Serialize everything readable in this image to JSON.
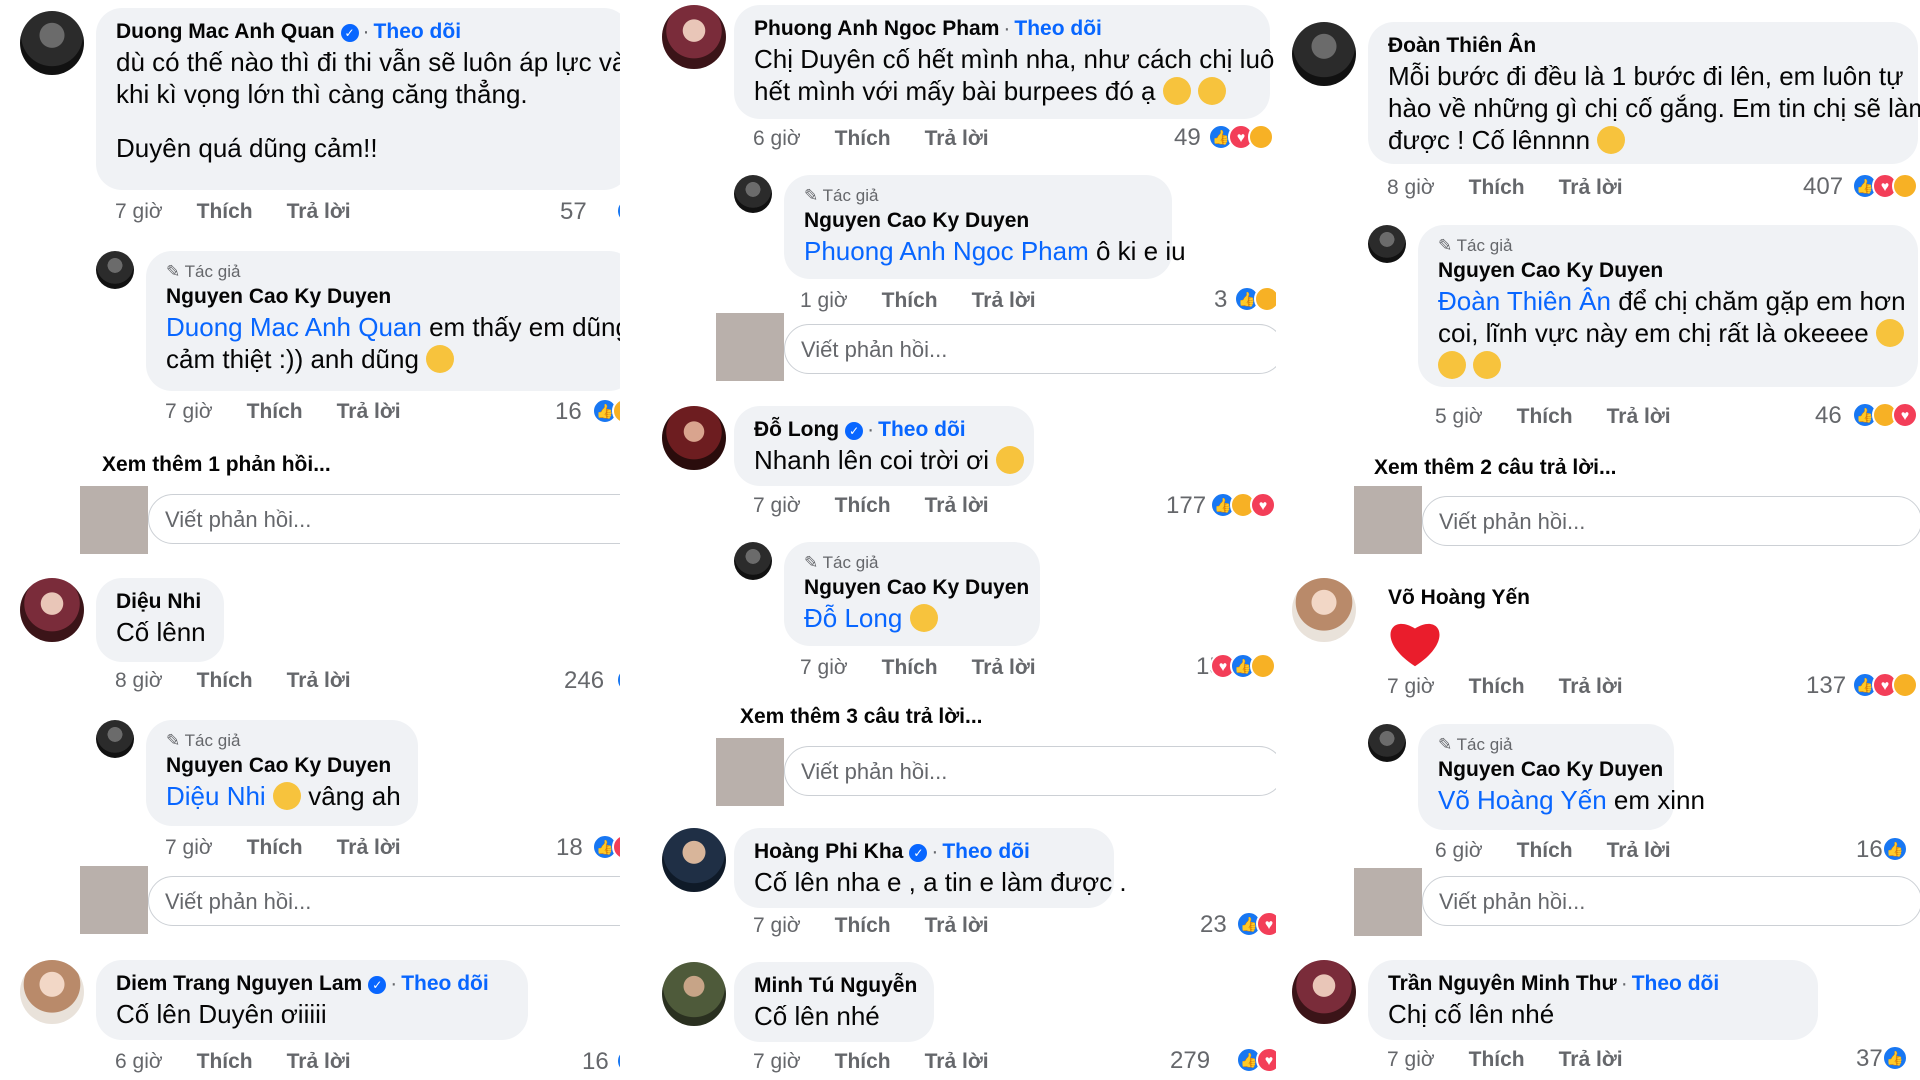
{
  "labels": {
    "follow": "Theo dõi",
    "like": "Thích",
    "reply": "Trả lời",
    "author": "Tác giả",
    "reply_placeholder": "Viết phản hồi..."
  },
  "col1": {
    "c1": {
      "name": "Duong Mac Anh Quan",
      "text": [
        "dù có thế nào thì đi thi vẫn sẽ luôn áp lực và",
        "khi kì vọng lớn thì càng căng thẳng.",
        "Duyên quá dũng cảm!!"
      ],
      "time": "7 giờ",
      "count": "57"
    },
    "r1": {
      "name": "Nguyen Cao Ky Duyen",
      "mention": "Duong Mac Anh Quan",
      "text1": " em thấy em dũng",
      "text2": "cảm thiệt :)) anh dũng",
      "time": "7 giờ",
      "count": "16"
    },
    "more1": "Xem thêm 1 phản hồi...",
    "c2": {
      "name": "Diệu Nhi",
      "text": "Cố lênn",
      "time": "8 giờ",
      "count": "246"
    },
    "r2": {
      "name": "Nguyen Cao Ky Duyen",
      "mention": "Diệu Nhi",
      "text": "vâng ah",
      "time": "7 giờ",
      "count": "18"
    },
    "c3": {
      "name": "Diem Trang Nguyen Lam",
      "text": "Cố lên Duyên ơiiiii",
      "time": "6 giờ",
      "count": "16"
    }
  },
  "col2": {
    "c1": {
      "name": "Phuong Anh Ngoc Pham",
      "text": [
        "Chị Duyên cố hết mình nha, như cách chị luôn",
        "hết mình với mấy bài burpees đó ạ"
      ],
      "time": "6 giờ",
      "count": "49"
    },
    "r1": {
      "name": "Nguyen Cao Ky Duyen",
      "mention": "Phuong Anh Ngoc Pham",
      "text": " ô ki e iu",
      "time": "1 giờ",
      "count": "3"
    },
    "c2": {
      "name": "Đỗ Long",
      "text": "Nhanh lên coi trời ơi",
      "time": "7 giờ",
      "count": "177"
    },
    "r2": {
      "name": "Nguyen Cao Ky Duyen",
      "mention": "Đỗ Long",
      "time": "7 giờ",
      "count": "15"
    },
    "more2": "Xem thêm 3 câu trả lời...",
    "c3": {
      "name": "Hoàng Phi Kha",
      "text": "Cố lên nha e , a tin e làm được .",
      "time": "7 giờ",
      "count": "23"
    },
    "c4": {
      "name": "Minh Tú Nguyễn",
      "text": "Cố lên nhé",
      "time": "7 giờ",
      "count": "279"
    }
  },
  "col3": {
    "c1": {
      "name": "Đoàn Thiên Ân",
      "text": [
        "Mỗi bước đi đều là 1 bước đi lên, em luôn tự",
        "hào về những gì chị cố gắng. Em tin chị sẽ làm",
        "được ! Cố lênnnn"
      ],
      "time": "8 giờ",
      "count": "407"
    },
    "r1": {
      "name": "Nguyen Cao Ky Duyen",
      "mention": "Đoàn Thiên Ân",
      "text1": " để chị chăm gặp em hơn",
      "text2": "coi, lĩnh vực này em chị rất là okeeee",
      "time": "5 giờ",
      "count": "46"
    },
    "more1": "Xem thêm 2 câu trả lời...",
    "c2": {
      "name": "Võ Hoàng Yến",
      "time": "7 giờ",
      "count": "137"
    },
    "r2": {
      "name": "Nguyen Cao Ky Duyen",
      "mention": "Võ Hoàng Yến",
      "text": " em xinn",
      "time": "6 giờ",
      "count": "16"
    },
    "c3": {
      "name": "Trần Nguyên Minh Thư",
      "text": "Chị cố lên nhé",
      "time": "7 giờ",
      "count": "37"
    }
  }
}
